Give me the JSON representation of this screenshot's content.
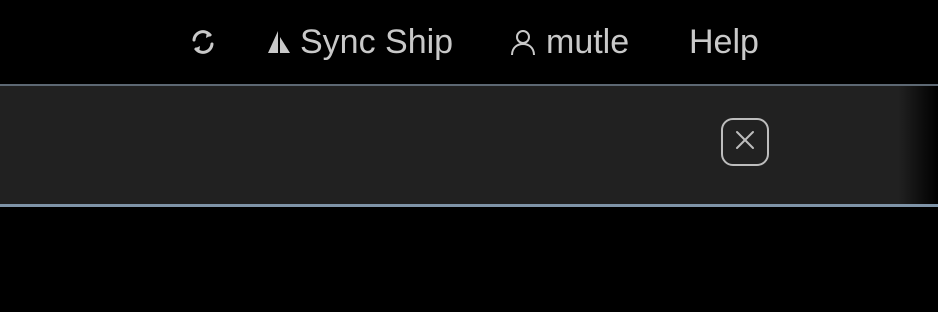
{
  "topbar": {
    "refresh_icon": "refresh-icon",
    "sync_ship": {
      "icon": "sail-icon",
      "label": "Sync Ship"
    },
    "user": {
      "icon": "user-icon",
      "label": "mutle"
    },
    "help_label": "Help"
  },
  "panel": {
    "close_icon": "close-icon"
  },
  "colors": {
    "background": "#000000",
    "panel": "#212121",
    "panel_border": "#7f94a8",
    "text": "#c9c9c9"
  }
}
